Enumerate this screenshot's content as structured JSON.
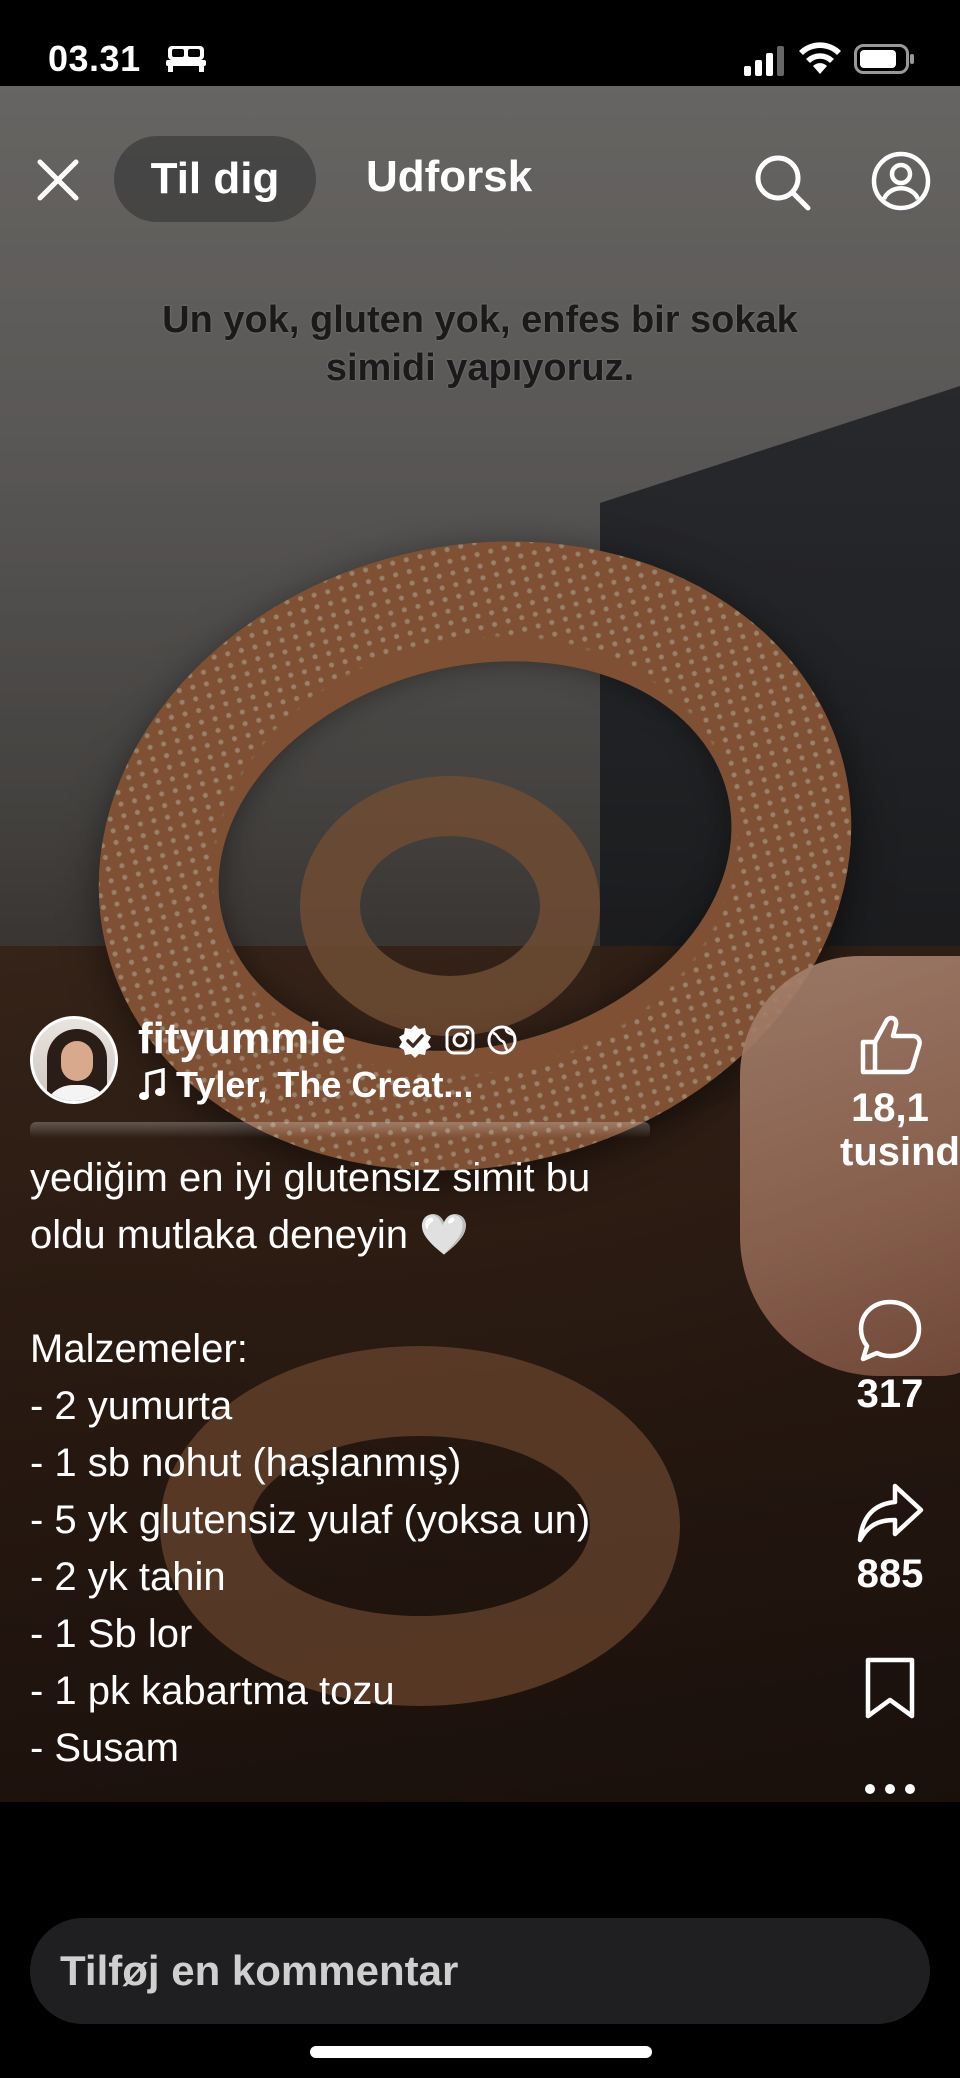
{
  "status_bar": {
    "time": "03.31",
    "icons": [
      "sleep-icon",
      "signal-icon",
      "wifi-icon",
      "battery-icon"
    ]
  },
  "nav": {
    "tabs": [
      {
        "label": "Til dig",
        "active": true
      },
      {
        "label": "Udforsk",
        "active": false
      }
    ],
    "icons": [
      "close-icon",
      "search-icon",
      "profile-icon"
    ]
  },
  "video": {
    "overlay_caption": "Un yok, gluten yok, enfes bir sokak simidi yapıyoruz."
  },
  "author": {
    "username": "fityummie",
    "verified": true,
    "music": "Tyler, The Creat..."
  },
  "caption": {
    "lines": [
      "yediğim en iyi glutensiz simit bu",
      "oldu mutlaka deneyin 🤍",
      "",
      "Malzemeler:",
      "- 2 yumurta",
      "- 1 sb nohut (haşlanmış)",
      "- 5 yk glutensiz yulaf (yoksa un)",
      "- 2 yk tahin",
      "- 1 Sb lor",
      "- 1 pk kabartma tozu",
      "- Susam"
    ]
  },
  "actions": {
    "likes": "18,1 tusind",
    "comments": "317",
    "shares": "885"
  },
  "comment_input": {
    "placeholder": "Tilføj en kommentar"
  },
  "colors": {
    "background": "#000000",
    "comment_bar": "#1f1f21",
    "tab_active_bg": "#3c3c3c",
    "text": "#ffffff"
  }
}
